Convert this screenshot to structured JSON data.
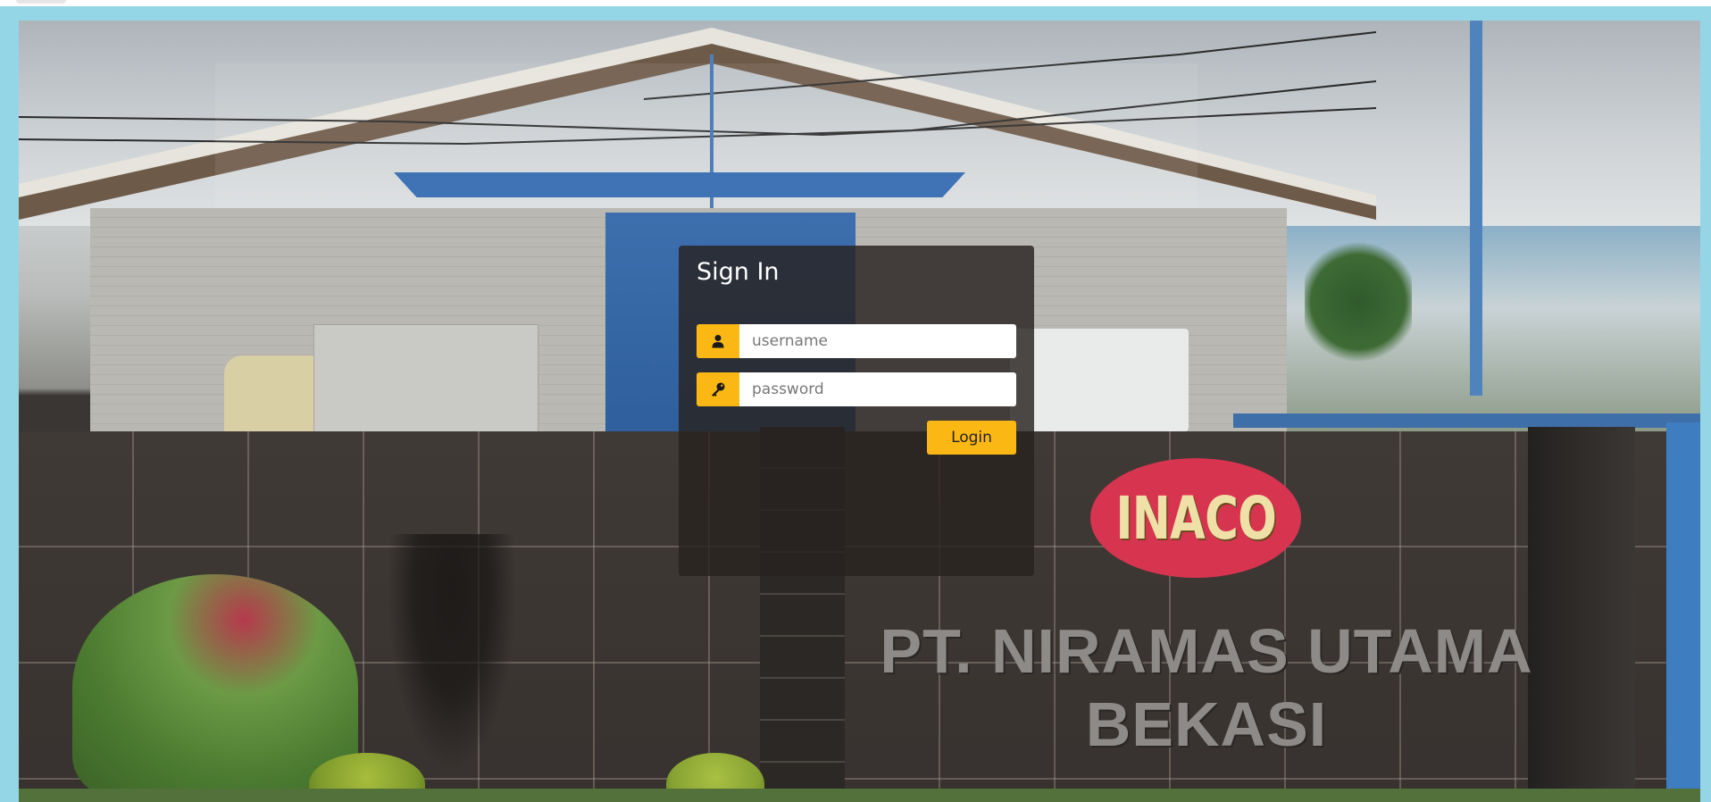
{
  "login": {
    "title": "Sign In",
    "username_placeholder": "username",
    "username_value": "",
    "password_placeholder": "password",
    "password_value": "",
    "submit_label": "Login",
    "accent_color": "#fbb714"
  },
  "background": {
    "logo_text": "INACO",
    "company_name_line1": "PT. NIRAMAS UTAMA",
    "company_name_line2": "BEKASI",
    "frame_color": "#95d6e6"
  },
  "icons": {
    "username": "user-icon",
    "password": "key-icon"
  }
}
